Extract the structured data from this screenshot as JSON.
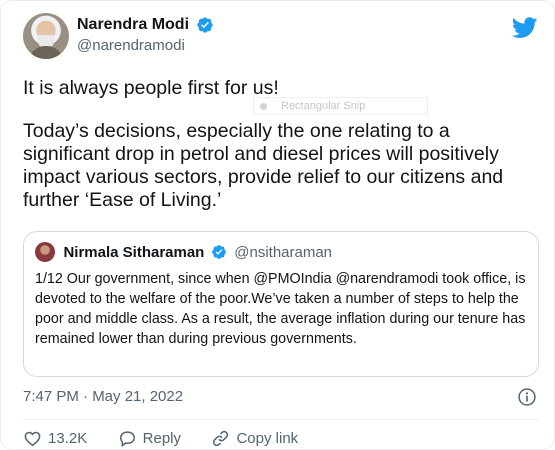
{
  "author": {
    "name": "Narendra Modi",
    "handle": "@narendramodi",
    "avatar_icon": "profile-photo",
    "verified_icon": "verified-badge-icon"
  },
  "tweet": {
    "line1": "It is always people first for us!",
    "line2": "Today’s decisions, especially the one relating to a significant drop in petrol and diesel prices will positively impact various sectors, provide relief to our citizens and further ‘Ease of Living.’"
  },
  "snip_overlay": {
    "label": "Rectangular Snip"
  },
  "quoted": {
    "name": "Nirmala Sitharaman",
    "handle": "@nsitharaman",
    "text_line1": "1/12  Our government, since when @PMOIndia @narendramodi took office, is",
    "text_line2": "devoted to the welfare of the poor.We’ve taken a number of steps to help the poor and middle class. As a result, the average inflation during our tenure has remained lower than during previous governments."
  },
  "meta": {
    "timestamp": "7:47 PM · May 21, 2022"
  },
  "actions": {
    "like_count": "13.2K",
    "reply_label": "Reply",
    "copy_link_label": "Copy link"
  },
  "colors": {
    "brand_blue": "#1d9bf0",
    "text": "#0f1419",
    "secondary": "#536471"
  }
}
